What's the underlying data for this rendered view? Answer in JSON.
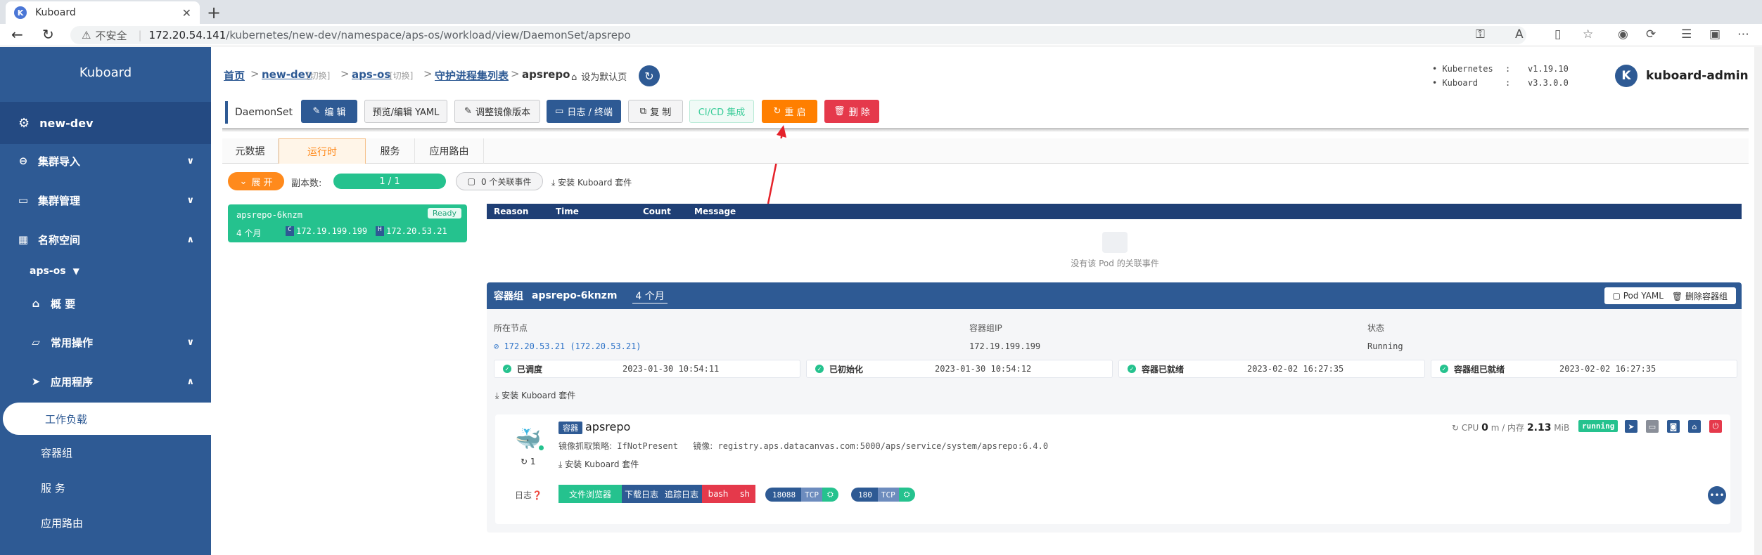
{
  "browser": {
    "tab_title": "Kuboard",
    "tab_favicon": "K",
    "url_warning": "不安全",
    "url_host": "172.20.54.141",
    "url_path": "/kubernetes/new-dev/namespace/aps-os/workload/view/DaemonSet/apsrepo"
  },
  "sidebar": {
    "title": "Kuboard",
    "cluster": "new-dev",
    "items": [
      {
        "label": "集群导入",
        "icon": "link-icon"
      },
      {
        "label": "集群管理",
        "icon": "monitor-icon"
      },
      {
        "label": "名称空间",
        "icon": "grid-icon"
      }
    ],
    "namespace": "aps-os",
    "ns_items": [
      {
        "label": "概 要",
        "icon": "home-icon"
      },
      {
        "label": "常用操作",
        "icon": "folder-icon"
      },
      {
        "label": "应用程序",
        "icon": "send-icon"
      }
    ],
    "app_items": [
      "工作负载",
      "容器组",
      "服 务",
      "应用路由"
    ]
  },
  "breadcrumb": {
    "home": "首页",
    "cluster": "new-dev",
    "switch": "[切换]",
    "namespace": "aps-os",
    "list": "守护进程集列表",
    "current": "apsrepo",
    "set_default": "设为默认页"
  },
  "versions": {
    "k8s_label": "Kubernetes",
    "k8s_value": "v1.19.10",
    "kb_label": "Kuboard",
    "kb_value": "v3.3.0.0"
  },
  "user": {
    "avatar": "K",
    "name": "kuboard-admin"
  },
  "toolbar": {
    "kind": "DaemonSet",
    "edit": "编 辑",
    "yaml": "预览/编辑 YAML",
    "image": "调整镜像版本",
    "logs": "日志 / 终端",
    "copy": "复 制",
    "cicd": "CI/CD 集成",
    "restart": "重 启",
    "delete": "删 除"
  },
  "tabs": [
    "元数据",
    "运行时",
    "服务",
    "应用路由"
  ],
  "runtime": {
    "expand": "展 开",
    "replica_label": "副本数:",
    "replica_value": "1 / 1",
    "events_btn": "0 个关联事件",
    "install": "安装 Kuboard 套件"
  },
  "pod": {
    "name": "apsrepo-6knzm",
    "status": "Ready",
    "age": "4 个月",
    "pod_ip": "172.19.199.199",
    "host_ip": "172.20.53.21"
  },
  "events": {
    "columns": [
      "Reason",
      "Time",
      "Count",
      "Message"
    ],
    "empty": "没有该 Pod 的关联事件"
  },
  "pod_group": {
    "title": "容器组",
    "name": "apsrepo-6knzm",
    "age": "4 个月",
    "pod_yaml": "Pod YAML",
    "delete": "删除容器组",
    "node_label": "所在节点",
    "node_value": "172.20.53.21 (172.20.53.21)",
    "ip_label": "容器组IP",
    "ip_value": "172.19.199.199",
    "state_label": "状态",
    "state_value": "Running",
    "conditions": [
      {
        "name": "已调度",
        "time": "2023-01-30 10:54:11"
      },
      {
        "name": "已初始化",
        "time": "2023-01-30 10:54:12"
      },
      {
        "name": "容器已就绪",
        "time": "2023-02-02 16:27:35"
      },
      {
        "name": "容器组已就绪",
        "time": "2023-02-02 16:27:35"
      }
    ],
    "install": "安装 Kuboard 套件"
  },
  "container": {
    "tag": "容器",
    "name": "apsrepo",
    "pull_label": "镜像抓取策略:",
    "pull_value": "IfNotPresent",
    "image_label": "镜像:",
    "image_value": "registry.aps.datacanvas.com:5000/aps/service/system/apsrepo:6.4.0",
    "install": "安装 Kuboard 套件",
    "restart_count": "1",
    "cpu_label": "CPU",
    "cpu_value": "0",
    "cpu_unit": "m / 内存",
    "mem_value": "2.13",
    "mem_unit": "MiB",
    "state": "running",
    "logs_label": "日志",
    "log_buttons": [
      "文件浏览器",
      "下载日志",
      "追踪日志",
      "bash",
      "sh"
    ],
    "ports": [
      {
        "port": "18088",
        "proto": "TCP"
      },
      {
        "port": "180",
        "proto": "TCP"
      }
    ]
  },
  "colors": {
    "primary": "#2e5a94",
    "accent": "#ff8a1c",
    "success": "#25c28e",
    "danger": "#e5394b"
  }
}
